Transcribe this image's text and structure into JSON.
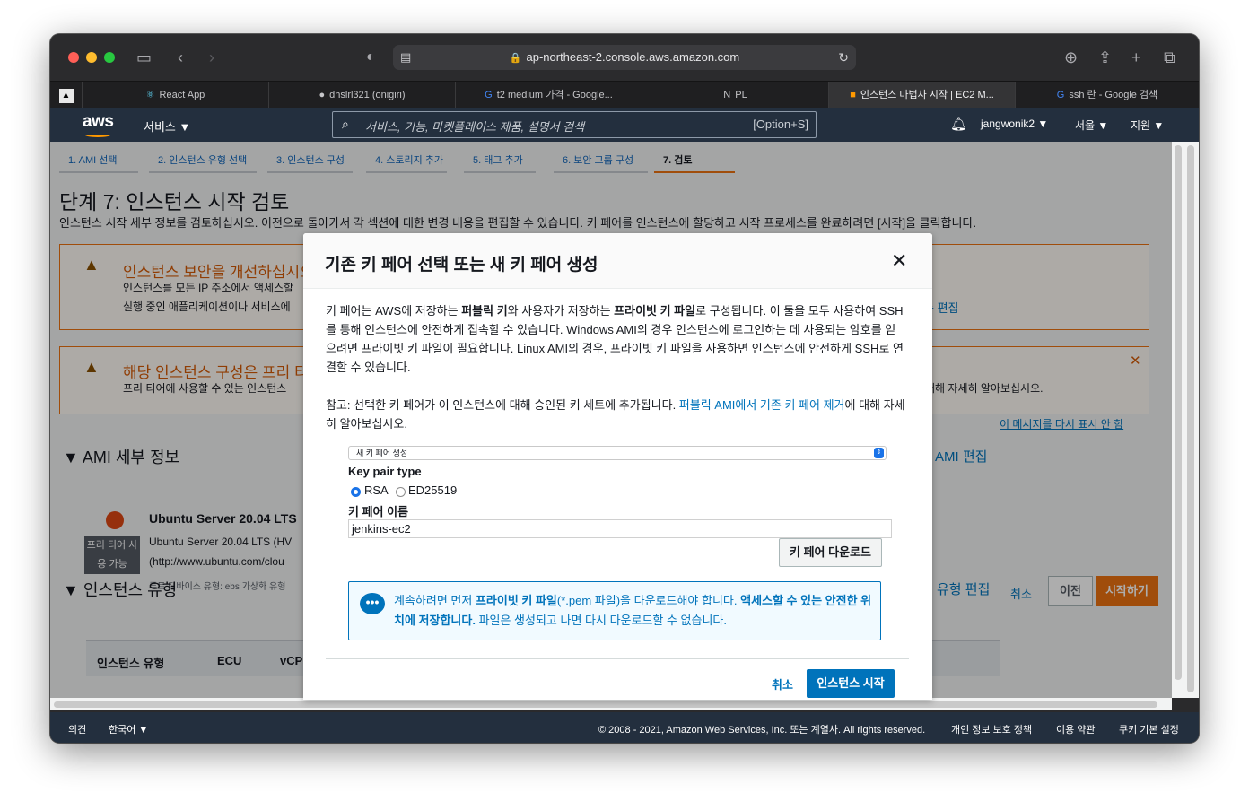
{
  "browser": {
    "url": "ap-northeast-2.console.aws.amazon.com",
    "tabs": [
      {
        "label": "React App",
        "icon": "react-icon"
      },
      {
        "label": "dhslrl321 (onigiri)",
        "icon": "github-icon"
      },
      {
        "label": "t2 medium 가격 - Google...",
        "icon": "google-icon"
      },
      {
        "label": "PL",
        "icon": "notion-icon"
      },
      {
        "label": "인스턴스 마법사 시작 | EC2 M...",
        "icon": "aws-box-icon"
      },
      {
        "label": "ssh 란 - Google 검색",
        "icon": "google-icon"
      }
    ]
  },
  "nav": {
    "logo": "aws",
    "services": "서비스 ▼",
    "search_placeholder": "서비스, 기능, 마켓플레이스 제품, 설명서 검색",
    "search_shortcut": "[Option+S]",
    "user": "jangwonik2 ▼",
    "region": "서울 ▼",
    "support": "지원 ▼"
  },
  "wizard": {
    "steps": [
      "1. AMI 선택",
      "2. 인스턴스 유형 선택",
      "3. 인스턴스 구성",
      "4. 스토리지 추가",
      "5. 태그 추가",
      "6. 보안 그룹 구성",
      "7. 검토"
    ],
    "title": "단계 7: 인스턴스 시작 검토",
    "description": "인스턴스 시작 세부 정보를 검토하십시오. 이전으로 돌아가서 각 섹션에 대한 변경 내용을 편집할 수 있습니다. 키 페어를 인스턴스에 할당하고 시작 프로세스를 완료하려면 [시작]을 클릭합니다.",
    "warning1": {
      "title": "인스턴스 보안을 개선하십시오",
      "line1": "인스턴스를 모든 IP 주소에서 액세스할",
      "line2": "실행 중인 애플리케이션이나 서비스에",
      "edit": "룹 편집"
    },
    "warning2": {
      "title": "해당 인스턴스 구성은 프리 티어",
      "line1": "프리 티어에 사용할 수 있는 인스턴스",
      "tail": "대해 자세히 알아보십시오.",
      "dismiss": "이 메시지를 다시 표시 안 함"
    },
    "ami_section": "AMI 세부 정보",
    "ami_edit": "AMI 편집",
    "ami_name": "Ubuntu Server 20.04 LTS",
    "ami_badge": "프리 티어 사용 가능",
    "ami_desc": "Ubuntu Server 20.04 LTS (HV",
    "ami_url": "(http://www.ubuntu.com/clou",
    "ami_meta": "루트 디바이스 유형: ebs     가상화 유형",
    "instance_section": "인스턴스 유형",
    "instance_edit": "유형 편집",
    "table_headers": [
      "인스턴스 유형",
      "ECU",
      "vCP"
    ],
    "cancel": "취소",
    "prev": "이전",
    "launch": "시작하기"
  },
  "modal": {
    "title": "기존 키 페어 선택 또는 새 키 페어 생성",
    "close": "✕",
    "para1_a": "키 페어는 AWS에 저장하는 ",
    "para1_b": "퍼블릭 키",
    "para1_c": "와 사용자가 저장하는 ",
    "para1_d": "프라이빗 키 파일",
    "para1_e": "로 구성됩니다. 이 둘을 모두 사용하여 SSH를 통해 인스턴스에 안전하게 접속할 수 있습니다. Windows AMI의 경우 인스턴스에 로그인하는 데 사용되는 암호를 얻으려면 프라이빗 키 파일이 필요합니다. Linux AMI의 경우, 프라이빗 키 파일을 사용하면 인스턴스에 안전하게 SSH로 연결할 수 있습니다.",
    "para2_a": "참고: 선택한 키 페어가 이 인스턴스에 대해 승인된 키 세트에 추가됩니다. ",
    "para2_link": "퍼블릭 AMI에서 기존 키 페어 제거",
    "para2_b": "에 대해 자세히 알아보십시오.",
    "select_value": "새 키 페어 생성",
    "key_type_label": "Key pair type",
    "radio_rsa": "RSA",
    "radio_ed": "ED25519",
    "key_name_label": "키 페어 이름",
    "key_name_value": "jenkins-ec2",
    "download": "키 페어 다운로드",
    "info_a": "계속하려면 먼저 ",
    "info_b": "프라이빗 키 파일",
    "info_c": "(*.pem 파일)을 다운로드해야 합니다. ",
    "info_d": "액세스할 수 있는 안전한 위치에 저장합니다.",
    "info_e": " 파일은 생성되고 나면 다시 다운로드할 수 없습니다.",
    "cancel": "취소",
    "launch": "인스턴스 시작"
  },
  "footer": {
    "feedback": "의견",
    "language": "한국어 ▼",
    "copyright": "© 2008 - 2021, Amazon Web Services, Inc. 또는 계열사. All rights reserved.",
    "privacy": "개인 정보 보호 정책",
    "terms": "이용 약관",
    "cookies": "쿠키 기본 설정"
  },
  "colors": {
    "aws_nav": "#232f3e",
    "aws_orange": "#ec7211",
    "link_blue": "#0073bb"
  }
}
